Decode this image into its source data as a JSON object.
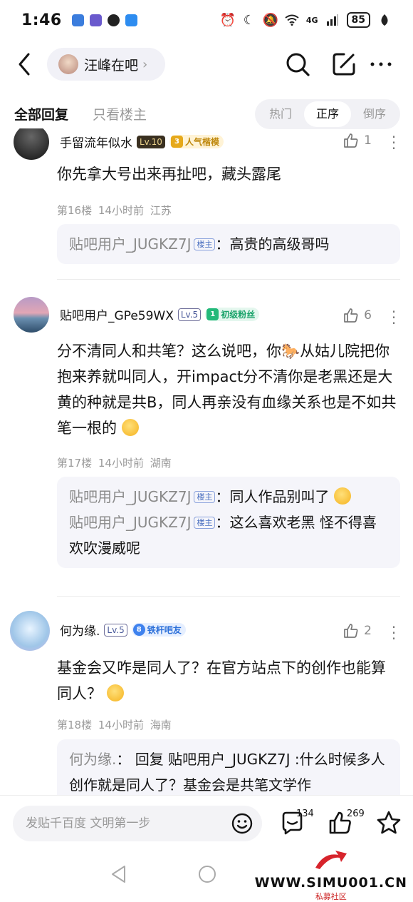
{
  "status_bar": {
    "time": "1:46",
    "network": "4G",
    "battery": "85"
  },
  "header": {
    "forum_name": "汪峰在吧"
  },
  "tabs": {
    "all_replies": "全部回复",
    "op_only": "只看楼主"
  },
  "sort": {
    "hot": "热门",
    "asc": "正序",
    "desc": "倒序"
  },
  "posts": [
    {
      "username": "手留流年似水",
      "level": "Lv.10",
      "badge_level": "3",
      "badge": "人气楷模",
      "likes": "1",
      "content": "你先拿大号出来再扯吧，藏头露尾",
      "floor": "第16楼",
      "time": "14小时前",
      "location": "江苏",
      "replies": [
        {
          "user": "贴吧用户_JUGKZ7J",
          "tag": "楼主",
          "text": "高贵的高级哥吗"
        }
      ]
    },
    {
      "username": "贴吧用户_GPe59WX",
      "level": "Lv.5",
      "badge_level": "1",
      "badge": "初级粉丝",
      "likes": "6",
      "content_1": "分不清同人和共笔？这么说吧，你",
      "content_2": "从姑儿院把你抱来养就叫同人，开impact分不清你是老黑还是大黄的种就是共B，同人再亲没有血缘关系也是不如共笔一根的",
      "floor": "第17楼",
      "time": "14小时前",
      "location": "湖南",
      "replies": [
        {
          "user": "贴吧用户_JUGKZ7J",
          "tag": "楼主",
          "text": "同人作品别叫了"
        },
        {
          "user": "贴吧用户_JUGKZ7J",
          "tag": "楼主",
          "text": "这么喜欢老黑 怪不得喜欢吹漫威呢"
        }
      ]
    },
    {
      "username": "何为缘.",
      "level": "Lv.5",
      "badge_level": "8",
      "badge": "铁杆吧友",
      "likes": "2",
      "content": "基金会又咋是同人了？在官方站点下的创作也能算同人？",
      "floor": "第18楼",
      "time": "14小时前",
      "location": "海南",
      "replies": [
        {
          "user": "何为缘.",
          "text": "回复 贴吧用户_JUGKZ7J :什么时候多人创作就是同人了？基金会是共笔文学作"
        }
      ]
    }
  ],
  "bottom_bar": {
    "input_placeholder": "发贴千百度 文明第一步",
    "comment_count": "134",
    "like_count": "269"
  },
  "watermark": {
    "text": "WWW.SIMU001.CN",
    "sub": "私募社区"
  },
  "colors": {
    "accent": "#3f82ee",
    "text": "#141414",
    "muted": "#999999"
  }
}
